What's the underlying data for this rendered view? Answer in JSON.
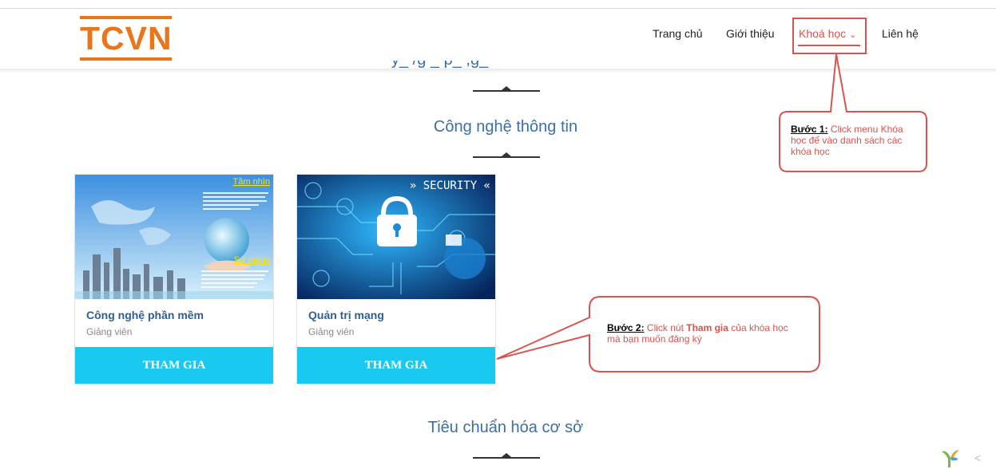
{
  "header": {
    "logo_text": "TCVN",
    "nav": [
      {
        "label": "Trang chủ"
      },
      {
        "label": "Giới thiệu"
      },
      {
        "label": "Khoá học",
        "caret": "⌄"
      },
      {
        "label": "Liên hệ"
      }
    ]
  },
  "sections": [
    {
      "title": "Công nghệ thông tin"
    },
    {
      "title": "Tiêu chuẩn hóa cơ sở"
    }
  ],
  "cards": [
    {
      "title": "Công nghệ phần mềm",
      "subtitle": "Giảng viên",
      "button": "THAM GIA",
      "image_labels": {
        "vision": "Tầm nhìn",
        "mission": "Sứ mệnh"
      }
    },
    {
      "title": "Quản trị mạng",
      "subtitle": "Giảng viên",
      "button": "THAM GIA",
      "image_labels": {
        "security": "» SECURITY «"
      }
    }
  ],
  "callouts": {
    "step1_label": "Bước 1:",
    "step1_text": " Click menu Khóa học để vào danh sách các khóa học",
    "step2_label": "Bước 2:",
    "step2_pre": " Click nút ",
    "step2_bold": "Tham gia",
    "step2_post": " của khóa học mà bạn muốn đăng ký"
  },
  "colors": {
    "brand": "#e8761d",
    "accent": "#19c9f0",
    "annotation": "#d9534f",
    "heading": "#3b6fa6"
  }
}
